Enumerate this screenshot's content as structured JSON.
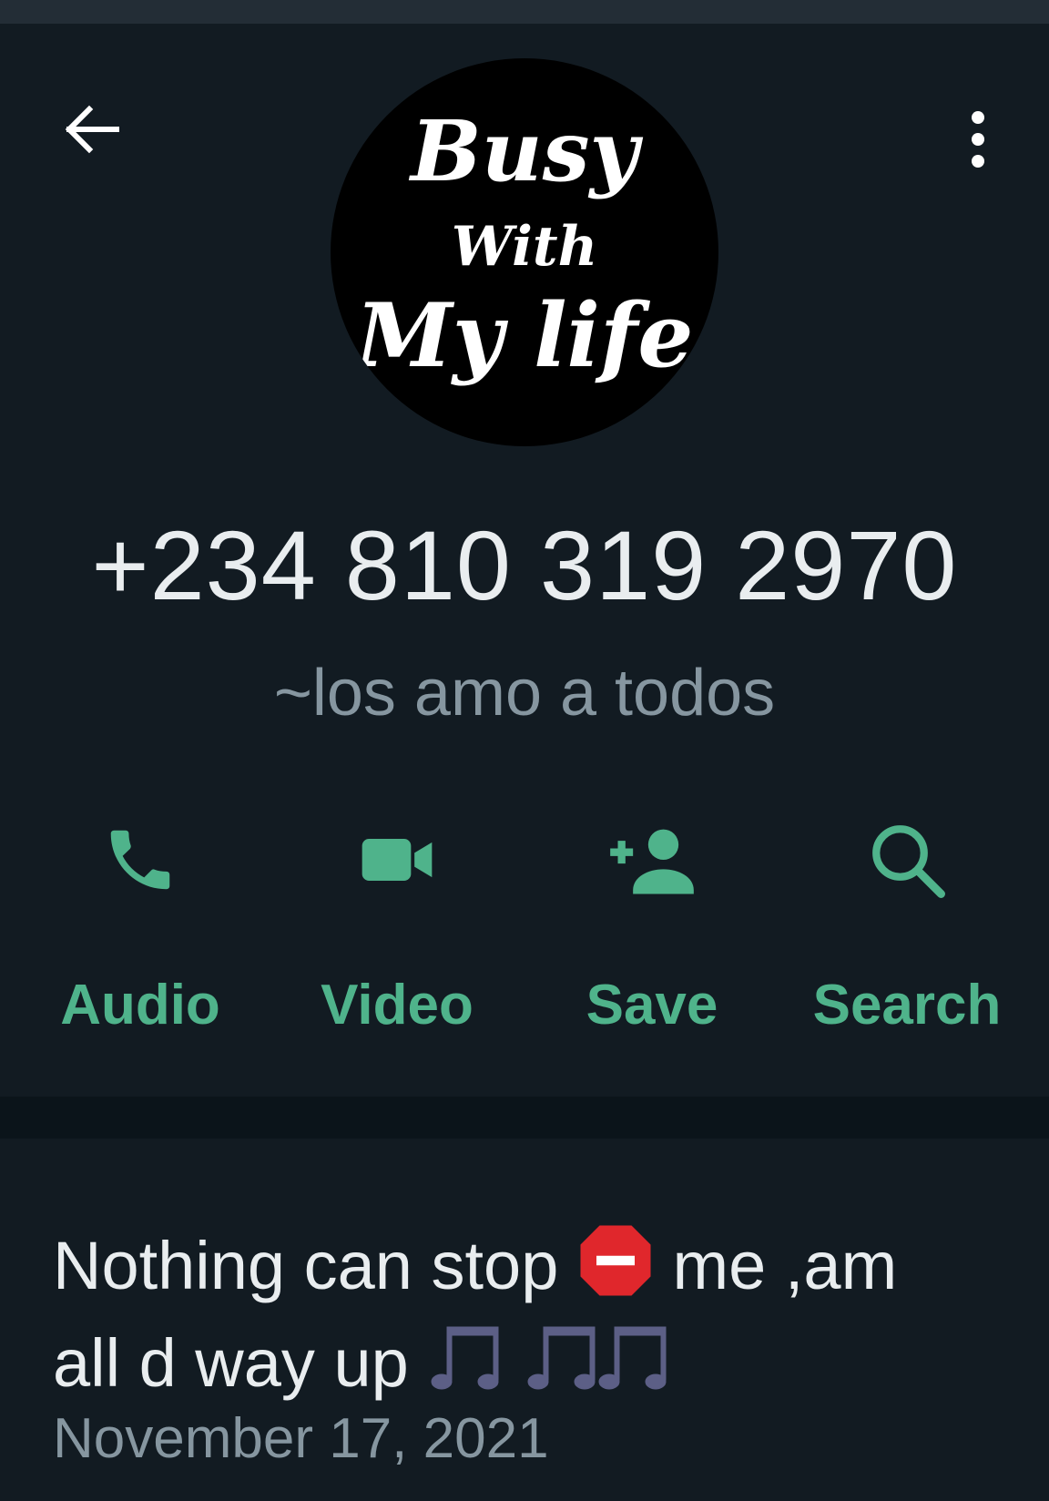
{
  "header": {
    "back_icon": "arrow-left-icon",
    "menu_icon": "more-vertical-icon"
  },
  "avatar": {
    "line1": "Busy",
    "line2": "With",
    "line3": "My life"
  },
  "contact": {
    "phone": "+234 810 319 2970",
    "about": "~los amo a todos"
  },
  "actions": [
    {
      "label": "Audio",
      "icon": "phone-icon"
    },
    {
      "label": "Video",
      "icon": "video-camera-icon"
    },
    {
      "label": "Save",
      "icon": "add-person-icon"
    },
    {
      "label": "Search",
      "icon": "search-icon"
    }
  ],
  "status": {
    "text_part1": "Nothing can stop",
    "text_part2": "me ,am",
    "text_part3": "all d way up",
    "stop_emoji": "stop-sign-icon",
    "music_emoji": "musical-notes-icon",
    "date": "November 17, 2021"
  },
  "colors": {
    "background": "#121b22",
    "accent": "#4fb38b",
    "primary_text": "#e9edef",
    "secondary_text": "#8696a0",
    "divider": "#0b141a"
  }
}
